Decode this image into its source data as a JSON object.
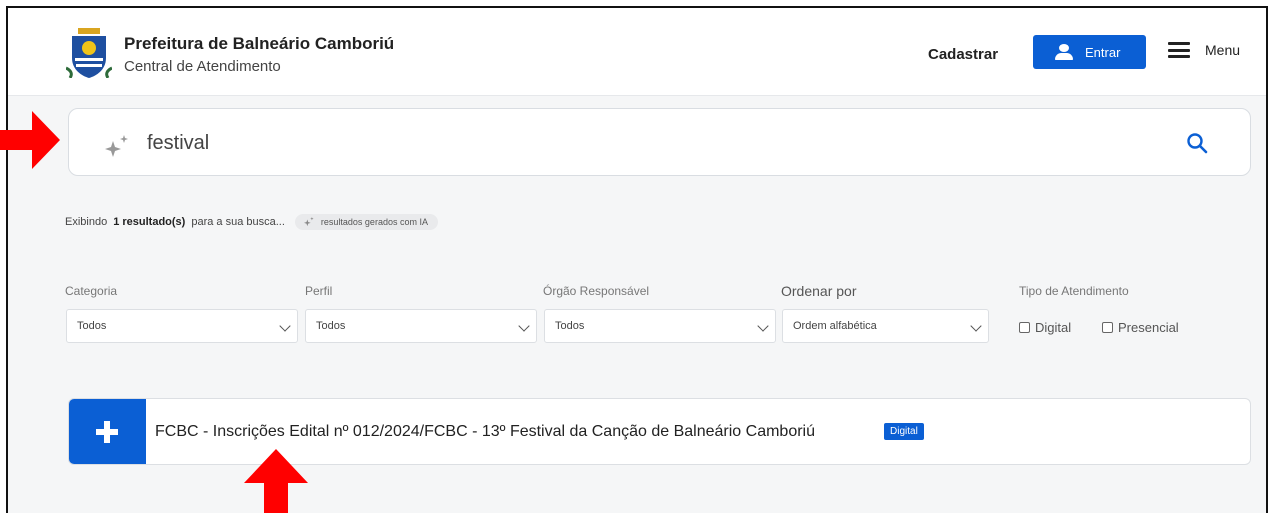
{
  "header": {
    "brand_title": "Prefeitura de Balneário Camboriú",
    "brand_subtitle": "Central de Atendimento",
    "register_label": "Cadastrar",
    "login_label": "Entrar",
    "menu_label": "Menu"
  },
  "search": {
    "value": "festival",
    "placeholder": ""
  },
  "summary": {
    "prefix": "Exibindo",
    "count_text": "1 resultado(s)",
    "suffix": "para a sua busca...",
    "ai_chip": "resultados gerados com IA"
  },
  "filters": {
    "category": {
      "label": "Categoria",
      "value": "Todos"
    },
    "profile": {
      "label": "Perfil",
      "value": "Todos"
    },
    "agency": {
      "label": "Órgão Responsável",
      "value": "Todos"
    },
    "sort": {
      "label": "Ordenar por",
      "value": "Ordem alfabética"
    },
    "service_type": {
      "label": "Tipo de Atendimento",
      "digital": "Digital",
      "in_person": "Presencial"
    }
  },
  "results": [
    {
      "title": "FCBC - Inscrições Edital nº 012/2024/FCBC - 13º Festival da Canção de Balneário Camboriú",
      "badge": "Digital"
    }
  ],
  "colors": {
    "accent": "#0b5fd4",
    "annotation": "#ff0000"
  },
  "icons": [
    "crest-logo-icon",
    "user-icon",
    "hamburger-menu-icon",
    "sparkle-icon",
    "search-icon",
    "chevron-down-icon",
    "plus-icon",
    "arrow-right-icon",
    "arrow-up-icon"
  ]
}
